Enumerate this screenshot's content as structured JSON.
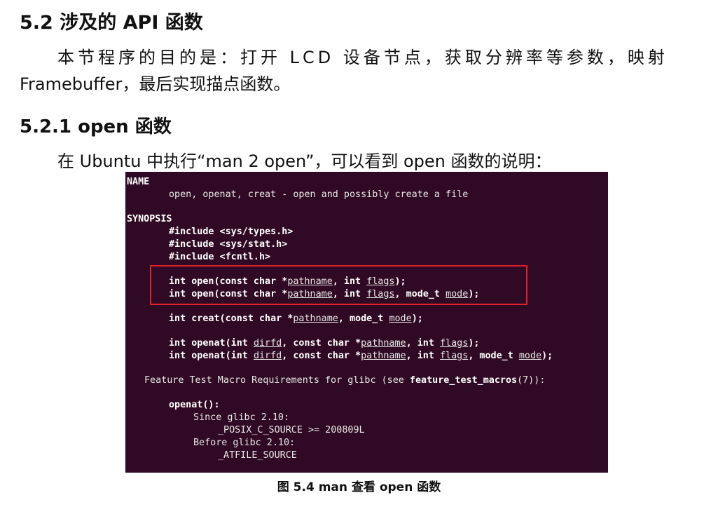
{
  "heading_5_2": "5.2 涉及的 API 函数",
  "para1": {
    "line1": "本节程序的目的是：打开 LCD 设备节点，获取分辨率等参数，映射",
    "line2": "Framebuffer，最后实现描点函数。"
  },
  "heading_5_2_1": "5.2.1 open 函数",
  "para2": "在 Ubuntu 中执行“man 2 open”，可以看到 open 函数的说明：",
  "terminal": {
    "background": "#300a24",
    "highlight_color": "#e0202a",
    "name_header": "NAME",
    "name_desc": "open, openat, creat - open and possibly create a file",
    "synopsis_header": "SYNOPSIS",
    "includes": [
      "#include <sys/types.h>",
      "#include <sys/stat.h>",
      "#include <fcntl.h>"
    ],
    "open1": {
      "a": "int open(const char *",
      "b": "pathname",
      "c": ", int ",
      "d": "flags",
      "e": ");"
    },
    "open2": {
      "a": "int open(const char *",
      "b": "pathname",
      "c": ", int ",
      "d": "flags",
      "e": ", mode_t ",
      "f": "mode",
      "g": ");"
    },
    "creat": {
      "a": "int creat(const char *",
      "b": "pathname",
      "c": ", mode_t ",
      "d": "mode",
      "e": ");"
    },
    "openat1": {
      "a": "int openat(int ",
      "b": "dirfd",
      "c": ", const char *",
      "d": "pathname",
      "e": ", int ",
      "f": "flags",
      "g": ");"
    },
    "openat2": {
      "a": "int openat(int ",
      "b": "dirfd",
      "c": ", const char *",
      "d": "pathname",
      "e": ", int ",
      "f": "flags",
      "g": ", mode_t ",
      "h": "mode",
      "i": ");"
    },
    "ftm": {
      "a": "Feature Test Macro Requirements for glibc (see ",
      "b": "feature_test_macros",
      "c": "(7)):"
    },
    "openat_label": "openat():",
    "since": "Since glibc 2.10:",
    "posix": "_POSIX_C_SOURCE >= 200809L",
    "before": "Before glibc 2.10:",
    "atfile": "_ATFILE_SOURCE"
  },
  "caption": "图 5.4 man 查看 open 函数"
}
